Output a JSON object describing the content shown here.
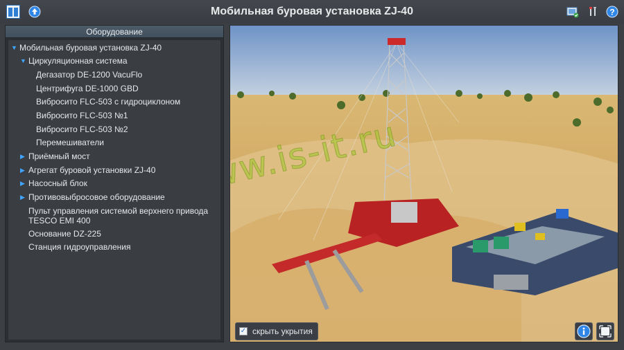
{
  "app": {
    "title": "Мобильная буровая установка ZJ-40"
  },
  "toolbar": {
    "left_icons": [
      "panel-layout-icon",
      "upload-arrow-icon"
    ],
    "right_icons": [
      "screenshot-icon",
      "tools-icon",
      "help-icon"
    ]
  },
  "panel": {
    "header": "Оборудование",
    "tree": [
      {
        "label": "Мобильная буровая установка ZJ-40",
        "level": 0,
        "expander": "expanded"
      },
      {
        "label": "Циркуляционная система",
        "level": 1,
        "expander": "expanded"
      },
      {
        "label": "Дегазатор DE-1200 VacuFlo",
        "level": 2,
        "expander": "none"
      },
      {
        "label": "Центрифуга DE-1000 GBD",
        "level": 2,
        "expander": "none"
      },
      {
        "label": "Вибросито FLC-503 с гидроциклоном",
        "level": 2,
        "expander": "none"
      },
      {
        "label": "Вибросито FLC-503 №1",
        "level": 2,
        "expander": "none"
      },
      {
        "label": "Вибросито FLC-503 №2",
        "level": 2,
        "expander": "none"
      },
      {
        "label": "Перемешиватели",
        "level": 2,
        "expander": "none"
      },
      {
        "label": "Приёмный мост",
        "level": 1,
        "expander": "collapsed"
      },
      {
        "label": "Агрегат буровой установки ZJ-40",
        "level": 1,
        "expander": "collapsed"
      },
      {
        "label": "Насосный блок",
        "level": 1,
        "expander": "collapsed"
      },
      {
        "label": "Противовыбросовое оборудование",
        "level": 1,
        "expander": "collapsed"
      },
      {
        "label": "Пульт управления системой верхнего привода\nTESCO EMI 400",
        "level": 1,
        "expander": "none"
      },
      {
        "label": "Основание DZ-225",
        "level": 1,
        "expander": "none"
      },
      {
        "label": "Станция гидроуправления",
        "level": 1,
        "expander": "none"
      }
    ]
  },
  "viewport": {
    "watermark": "www.is-it.ru",
    "hide_cover_label": "скрыть укрытия",
    "hide_cover_checked": true,
    "buttons": [
      "info-icon",
      "fit-view-icon"
    ],
    "accent_color": "#3fa6ff"
  }
}
